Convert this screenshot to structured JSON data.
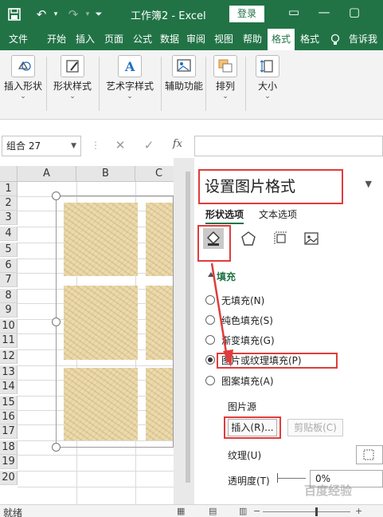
{
  "window": {
    "title": "工作簿2  -  Excel",
    "login_label": "登录"
  },
  "quick_access": {
    "save": "save-icon",
    "undo": "undo-icon",
    "redo": "redo-icon",
    "customize": "customize-qat-icon"
  },
  "tabs": [
    {
      "label": "文件"
    },
    {
      "label": "开始"
    },
    {
      "label": "插入"
    },
    {
      "label": "页面"
    },
    {
      "label": "公式"
    },
    {
      "label": "数据"
    },
    {
      "label": "审阅"
    },
    {
      "label": "视图"
    },
    {
      "label": "帮助"
    },
    {
      "label": "格式"
    },
    {
      "label": "格式"
    },
    {
      "label": "告诉我"
    }
  ],
  "ribbon": {
    "groups": [
      {
        "label": "插入形状"
      },
      {
        "label": "形状样式"
      },
      {
        "label": "艺术字样式"
      },
      {
        "label": "辅助功能"
      },
      {
        "label": "排列"
      },
      {
        "label": "大小"
      }
    ]
  },
  "formula_bar": {
    "name_box": "组合 27",
    "cancel": "✕",
    "enter": "✓",
    "fx": "fx"
  },
  "grid": {
    "columns": [
      "A",
      "B",
      "C"
    ],
    "rows": [
      "1",
      "2",
      "3",
      "4",
      "5",
      "6",
      "7",
      "8",
      "9",
      "10",
      "11",
      "12",
      "13",
      "14",
      "15",
      "16",
      "17",
      "18",
      "19",
      "20"
    ]
  },
  "pane": {
    "title": "设置图片格式",
    "tabs": [
      "形状选项",
      "文本选项"
    ],
    "section": "填充",
    "fill_options": [
      {
        "label": "无填充(N)",
        "selected": false
      },
      {
        "label": "纯色填充(S)",
        "selected": false
      },
      {
        "label": "渐变填充(G)",
        "selected": false
      },
      {
        "label": "图片或纹理填充(P)",
        "selected": true
      },
      {
        "label": "图案填充(A)",
        "selected": false
      }
    ],
    "picture_source": "图片源",
    "insert_button": "插入(R)...",
    "clipboard_button": "剪贴板(C)",
    "texture_label": "纹理(U)",
    "transparency_label": "透明度(T)",
    "transparency_value": "0%"
  },
  "status": {
    "text": "就绪"
  },
  "watermark": "百度经验",
  "accent_colors": {
    "excel_green": "#217346",
    "annotation_red": "#e03c3c"
  }
}
